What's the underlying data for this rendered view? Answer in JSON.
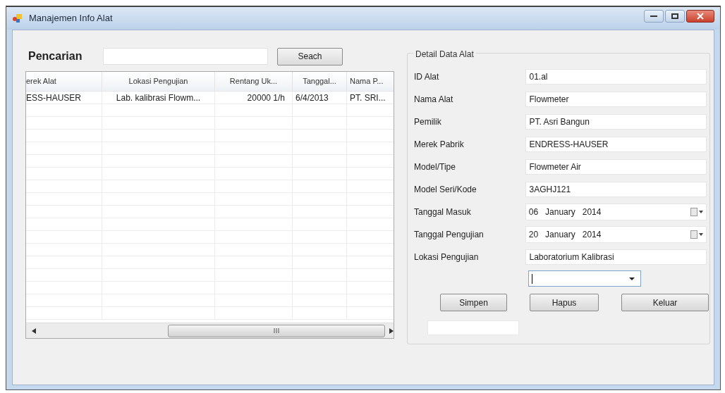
{
  "window": {
    "title": "Manajemen Info Alat"
  },
  "search": {
    "label": "Pencarian",
    "button": "Seach"
  },
  "table": {
    "columns": [
      "erek Alat",
      "Lokasi Pengujian",
      "Rentang Uk...",
      "Tanggal...",
      "Nama P..."
    ],
    "rows": [
      [
        "ESS-HAUSER",
        "Lab. kalibrasi Flowm...",
        "20000 1/h",
        "6/4/2013",
        "PT. SRI..."
      ]
    ]
  },
  "detail": {
    "title": "Detail Data Alat",
    "fields": [
      {
        "kind": "text",
        "label": "ID Alat",
        "value": "01.al"
      },
      {
        "kind": "text",
        "label": "Nama Alat",
        "value": "Flowmeter"
      },
      {
        "kind": "text",
        "label": "Pemilik",
        "value": "PT. Asri Bangun"
      },
      {
        "kind": "text",
        "label": "Merek Pabrik",
        "value": "ENDRESS-HAUSER"
      },
      {
        "kind": "text",
        "label": "Model/Tipe",
        "value": "Flowmeter Air"
      },
      {
        "kind": "text",
        "label": "Model Seri/Kode",
        "value": "3AGHJ121"
      },
      {
        "kind": "date",
        "label": "Tanggal Masuk",
        "value": "06   January   2014"
      },
      {
        "kind": "date",
        "label": "Tanggal Pengujian",
        "value": "20   January   2014"
      },
      {
        "kind": "text",
        "label": "Lokasi Pengujian",
        "value": "Laboratorium Kalibrasi"
      }
    ],
    "buttons": [
      "Simpen",
      "Hapus",
      "Keluar"
    ]
  }
}
